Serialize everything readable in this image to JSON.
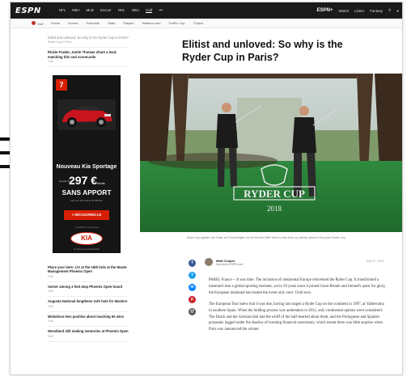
{
  "nav": {
    "logo": "ESPN",
    "links": [
      "NFL",
      "NBA",
      "MLB",
      "Soccer",
      "NHL",
      "NBA",
      "Golf",
      "•••"
    ],
    "active_index": 6,
    "right_brand": "ESPN+",
    "right_links": [
      "Watch",
      "Listen",
      "Fantasy"
    ]
  },
  "subnav": {
    "items": [
      "Golf",
      "Home",
      "Scores",
      "Schedule",
      "Stats",
      "Players",
      "Masters.com",
      "FedEx Cup",
      "TOpics"
    ]
  },
  "sidebar": {
    "top_items": [
      {
        "title": "Elitist and unloved: So why is the Ryder Cup in Paris?",
        "meta": "Ryder Cup in Paris",
        "faded": true
      },
      {
        "title": "Rickie Fowler, Justin Thomas share a lead, matching hits and scorecards",
        "meta": "Golf",
        "faded": false
      }
    ],
    "bottom_items": [
      {
        "title": "Place your bets: LIV at the 16th hole at the Waste Management Phoenix Open",
        "meta": "Golf"
      },
      {
        "title": "Varner among 3 tied atop Phoenix Open board",
        "meta": "Golf"
      },
      {
        "title": "Augusta National lengthens 11th hole for Masters",
        "meta": "Golf"
      },
      {
        "title": "Mickelson less positive about reaching 50 wins",
        "meta": "Golf"
      },
      {
        "title": "Woodland still making memories at Phoenix Open",
        "meta": "Golf"
      }
    ]
  },
  "ad": {
    "badge": "7",
    "title": "Nouveau Kia Sportage",
    "price_prefix": "à partir de",
    "price": "297 €",
    "price_suffix": "/mois",
    "headline": "SANS APPORT",
    "small": "LLD sur 49 mois et 40 000 km",
    "cta": "> DÉCOUVREZ-LE",
    "legal": "* Conditions sur kia.com",
    "brand": "KIA",
    "tagline": "Le Pouvoir de Surprendre"
  },
  "article": {
    "headline": "Elitist and unloved: So why is the Ryder Cup in Paris?",
    "hero_logo_text": "RYDER CUP",
    "hero_year": "2018",
    "caption": "Ryder Cup captains Jim Furyk and Thomas Bjørn tee off from the Eiffel Tower to help drum up publicity ahead of this year's Ryder Cup.",
    "author": "Matt Cooper",
    "author_sub": "Special to ESPN.com",
    "date": "Sep 27, 2018",
    "paragraphs": [
      "PARIS, France -- It was time. The inclusion of continental Europe reinvented the Ryder Cup. It transformed a mismatch into a global sporting moment, yet in 39 years since it joined Great Britain and Ireland's quest for glory, the European mainland has hosted the event only once. Until now.",
      "The European Tour knew that it was due, having last staged a Ryder Cup on the continent in 1997, at Valderrama in southern Spain. When the bidding process was undertaken in 2011, only continental options were considered. The Dutch and the German bids had the whiff of the half-hearted about them, and the Portuguese and Spanish proposals lugged under the shadow of looming financial uncertainty, which meant there was little surprise when Paris was announced the winner."
    ]
  },
  "colors": {
    "nav_bg": "#1a1a1a",
    "accent_red": "#d81e05",
    "facebook": "#3b5998",
    "twitter": "#1da1f2",
    "pinterest": "#cb2027",
    "email": "#555555"
  },
  "social_icons": [
    "facebook-icon",
    "twitter-icon",
    "messenger-icon",
    "pinterest-icon",
    "email-icon"
  ]
}
